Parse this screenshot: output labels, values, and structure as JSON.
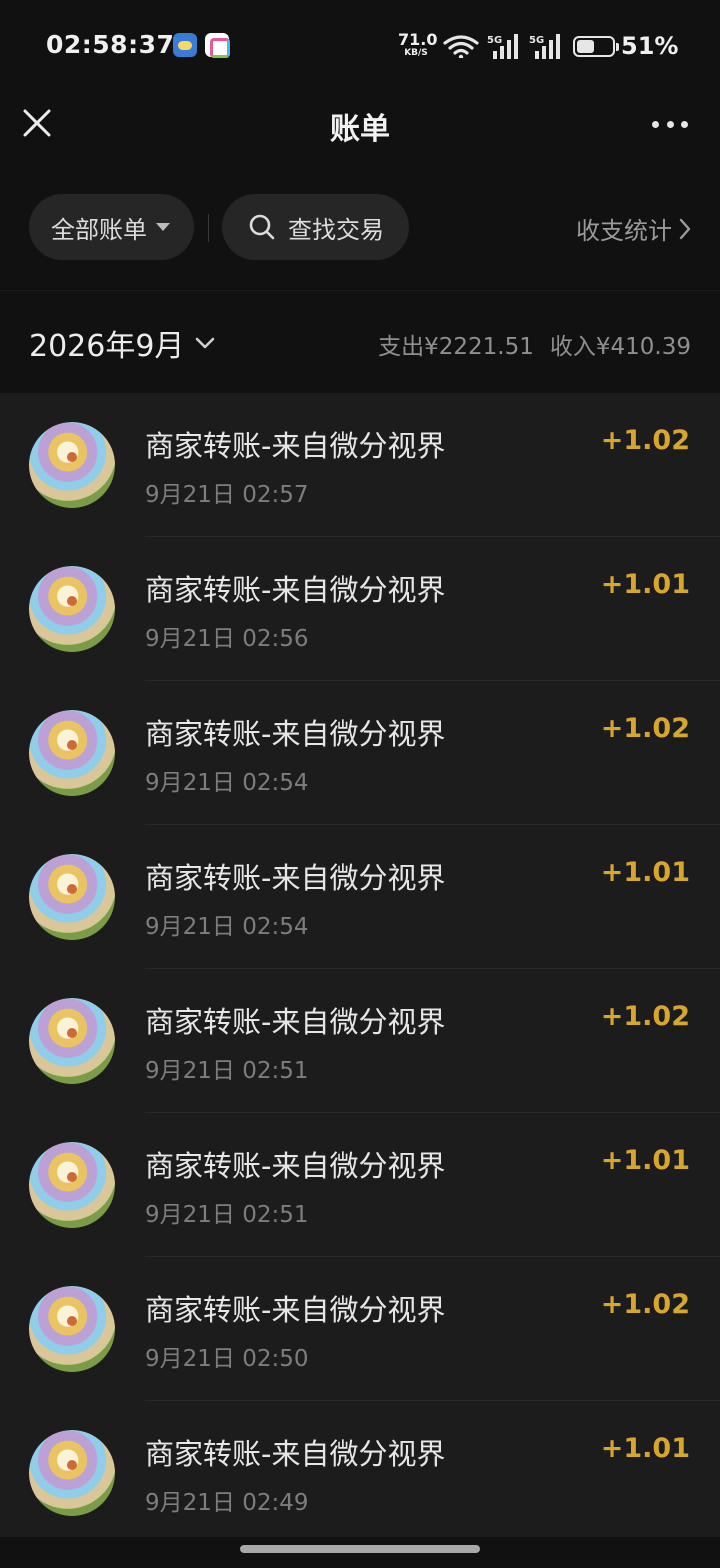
{
  "status_bar": {
    "time": "02:58:37",
    "net_speed_value": "71.0",
    "net_speed_unit": "KB/S",
    "signal_1": "5G",
    "signal_2": "5G",
    "battery_percent": "51%",
    "battery_level": 0.51,
    "icons": [
      "weather-app-icon",
      "gallery-app-icon",
      "wifi-icon",
      "cellular-signal-icon",
      "cellular-signal-icon",
      "battery-icon"
    ]
  },
  "nav": {
    "title": "账单",
    "close_icon": "close-icon",
    "more_icon": "more-icon"
  },
  "filters": {
    "all_bills": "全部账单",
    "search": "查找交易",
    "stats": "收支统计"
  },
  "month": {
    "label": "2026年9月",
    "expense": "支出¥2221.51",
    "income": "收入¥410.39"
  },
  "transactions": [
    {
      "title": "商家转账-来自微分视界",
      "time": "9月21日 02:57",
      "amount": "+1.02"
    },
    {
      "title": "商家转账-来自微分视界",
      "time": "9月21日 02:56",
      "amount": "+1.01"
    },
    {
      "title": "商家转账-来自微分视界",
      "time": "9月21日 02:54",
      "amount": "+1.02"
    },
    {
      "title": "商家转账-来自微分视界",
      "time": "9月21日 02:54",
      "amount": "+1.01"
    },
    {
      "title": "商家转账-来自微分视界",
      "time": "9月21日 02:51",
      "amount": "+1.02"
    },
    {
      "title": "商家转账-来自微分视界",
      "time": "9月21日 02:51",
      "amount": "+1.01"
    },
    {
      "title": "商家转账-来自微分视界",
      "time": "9月21日 02:50",
      "amount": "+1.02"
    },
    {
      "title": "商家转账-来自微分视界",
      "time": "9月21日 02:49",
      "amount": "+1.01"
    }
  ],
  "colors": {
    "background": "#111111",
    "list_background": "#1c1c1c",
    "amount": "#d6a631",
    "pill": "#262626"
  }
}
